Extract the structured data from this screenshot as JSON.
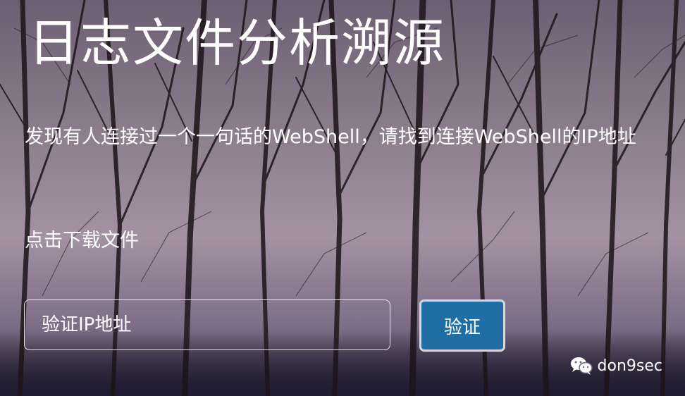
{
  "page": {
    "title": "日志文件分析溯源",
    "description": "发现有人连接过一个一句话的WebShell，请找到连接WebShell的IP地址",
    "download_link": "点击下载文件"
  },
  "form": {
    "ip_placeholder": "验证IP地址",
    "verify_label": "验证"
  },
  "watermark": {
    "icon": "wechat-icon",
    "text": "don9sec"
  },
  "colors": {
    "button_bg": "#1f6ea6",
    "sky_top": "#6b5f74",
    "sky_mid": "#a492a3",
    "ground": "#3a3350"
  }
}
